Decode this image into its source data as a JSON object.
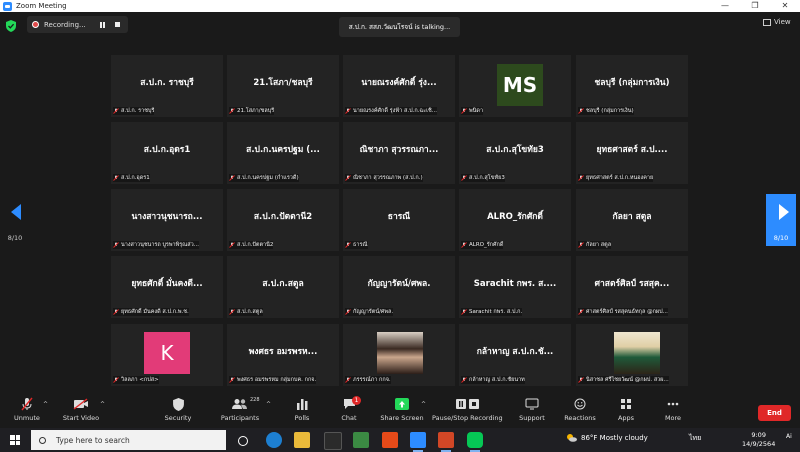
{
  "window": {
    "title": "Zoom Meeting",
    "controls": [
      "—",
      "❐",
      "✕"
    ]
  },
  "top": {
    "recording_label": "Recording...",
    "talking_text": "ส.ป.ก. สสภ.วัฒนโรจน์ is  talking...",
    "view_label": "View"
  },
  "grid": {
    "page_left": "8/10",
    "page_right": "8/10",
    "tiles": [
      {
        "name": "ส.ป.ก. ราชบุรี",
        "label": "ส.ป.ก. ราชบุรี"
      },
      {
        "name": "21.โสภา/ชลบุรี",
        "label": "21.โสภา/ชลบุรี"
      },
      {
        "name": "นายณรงค์ศักดิ์ รุ่ง...",
        "label": "นายณรงค์ศักดิ์ รุ่งฟ้า ส.ป.ก.ฉะเชิ..."
      },
      {
        "name": "",
        "avatar_text": "MS",
        "label": "พนิดา"
      },
      {
        "name": "ชลบุรี (กลุ่มการเงิน)",
        "label": "ชลบุรี (กลุ่มการเงิน)"
      },
      {
        "name": "ส.ป.ก.อุดร1",
        "label": "ส.ป.ก.อุดร1"
      },
      {
        "name": "ส.ป.ก.นครปฐม (...",
        "label": "ส.ป.ก.นครปฐม (กำแรวดี)"
      },
      {
        "name": "ณิชาภา สุวรรณภา...",
        "label": "ณิชาภา สุวรรณภาพ (ส.ป.ก.)"
      },
      {
        "name": "ส.ป.ก.สุโขทัย3",
        "label": "ส.ป.ก.สุโขทัย3"
      },
      {
        "name": "ยุทธศาสตร์ ส.ป....",
        "label": "ยุทธศาสตร์ ส.ป.ก.หนองคาย"
      },
      {
        "name": "นางสาวนุชนารถ...",
        "label": "นางสาวนุชนารถ บูรพาพิรุณส่ว..."
      },
      {
        "name": "ส.ป.ก.ปัตตานี2",
        "label": "ส.ป.ก.ปัตตานี2"
      },
      {
        "name": "ธารณี",
        "label": "ธารณี"
      },
      {
        "name": "ALRO_รักศักดิ์",
        "label": "ALRO_รักศักดิ์"
      },
      {
        "name": "กัลยา สตูล",
        "label": "กัลยา สตูล"
      },
      {
        "name": "ยุทธศักดิ์ มั่นคงดี...",
        "label": "ยุทธศักดิ์ มั่นคงดี ส.ป.ก.พ.ช."
      },
      {
        "name": "ส.ป.ก.สตูล",
        "label": "ส.ป.ก.สตูล"
      },
      {
        "name": "กัญญารัตน์/ศพล.",
        "label": "กัญญารัตน์/ศพล."
      },
      {
        "name": "Sarachit กพร. ส....",
        "label": "Sarachit กพร. ส.ป.ก."
      },
      {
        "name": "ศาสตร์ศิลป์ รสสุค...",
        "label": "ศาสตร์ศิลป์ รสสุคนธ์ทกุล @กผป..."
      },
      {
        "name": "",
        "avatar_text": "K",
        "label": "วิลลภา <กปส>"
      },
      {
        "name": "พงศธร อมรพรห...",
        "label": "พงศธร อมรพรหม กลุ่มกบค. กกจ."
      },
      {
        "name": "",
        "photo": "portrait-1",
        "label": "ภรรรณ์ภา กกจ."
      },
      {
        "name": "กล้าหาญ ส.ป.ก.ชั...",
        "label": "กล้าหาญ ส.ป.ก.ชัยนาท"
      },
      {
        "name": "",
        "photo": "portrait-2",
        "label": "นิสาชล ศรีไชยวัฒน์ @กผป. สวผ..."
      }
    ]
  },
  "toolbar": {
    "unmute": "Unmute",
    "start_video": "Start Video",
    "security": "Security",
    "participants": "Participants",
    "participants_count": "228",
    "polls": "Polls",
    "chat": "Chat",
    "chat_badge": "1",
    "share_screen": "Share Screen",
    "record": "Pause/Stop Recording",
    "support": "Support",
    "reactions": "Reactions",
    "apps": "Apps",
    "more": "More",
    "end": "End"
  },
  "taskbar": {
    "search_placeholder": "Type here to search",
    "weather": "86°F  Mostly cloudy",
    "lang": "ไทย",
    "time": "9:09",
    "date": "14/9/2564",
    "ai_label": "Ai"
  },
  "colors": {
    "zoom_blue": "#2d8cff",
    "end_red": "#e02828",
    "share_green": "#23d959"
  }
}
